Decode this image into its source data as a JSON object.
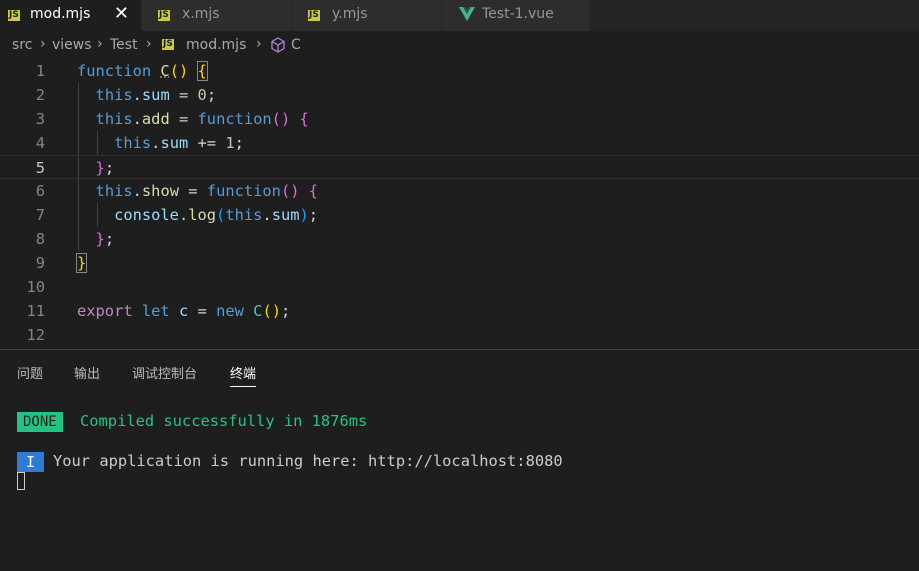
{
  "tabs": [
    {
      "label": "mod.mjs",
      "icon": "js-icon",
      "active": true,
      "close": "✕"
    },
    {
      "label": "x.mjs",
      "icon": "js-icon",
      "active": false
    },
    {
      "label": "y.mjs",
      "icon": "js-icon",
      "active": false
    },
    {
      "label": "Test-1.vue",
      "icon": "vue-icon",
      "active": false
    }
  ],
  "icon_text": {
    "js": "JS"
  },
  "breadcrumb": {
    "items": [
      "src",
      "views",
      "Test",
      "mod.mjs",
      "C"
    ],
    "separator": "›"
  },
  "editor": {
    "line_numbers": [
      "1",
      "2",
      "3",
      "4",
      "5",
      "6",
      "7",
      "8",
      "9",
      "10",
      "11",
      "12"
    ],
    "tokens": {
      "function": "function",
      "C": "C",
      "this": "this",
      "sum": "sum",
      "add": "add",
      "show": "show",
      "console": "console",
      "log": "log",
      "export": "export",
      "let": "let",
      "c": "c",
      "new": "new",
      "zero": "0",
      "one": "1",
      "eq": " = ",
      "pluseq": " += ",
      "dot": ".",
      "semi": ";"
    }
  },
  "panel": {
    "tabs": [
      "问题",
      "输出",
      "调试控制台",
      "终端"
    ],
    "active_tab": "终端",
    "terminal": {
      "done_badge": "DONE",
      "done_text": "Compiled successfully in 1876ms",
      "info_badge": "I",
      "info_text": "Your application is running here: http://localhost:8080"
    }
  },
  "colors": {
    "background": "#1e1e1e",
    "keyword": "#569cd6",
    "property": "#9cdcfe",
    "function": "#dcdcaa",
    "number": "#b5cea8",
    "done_green": "#23c483",
    "info_blue": "#2f7bd6",
    "js_yellow": "#cbcb41",
    "vue_green": "#41b883"
  }
}
